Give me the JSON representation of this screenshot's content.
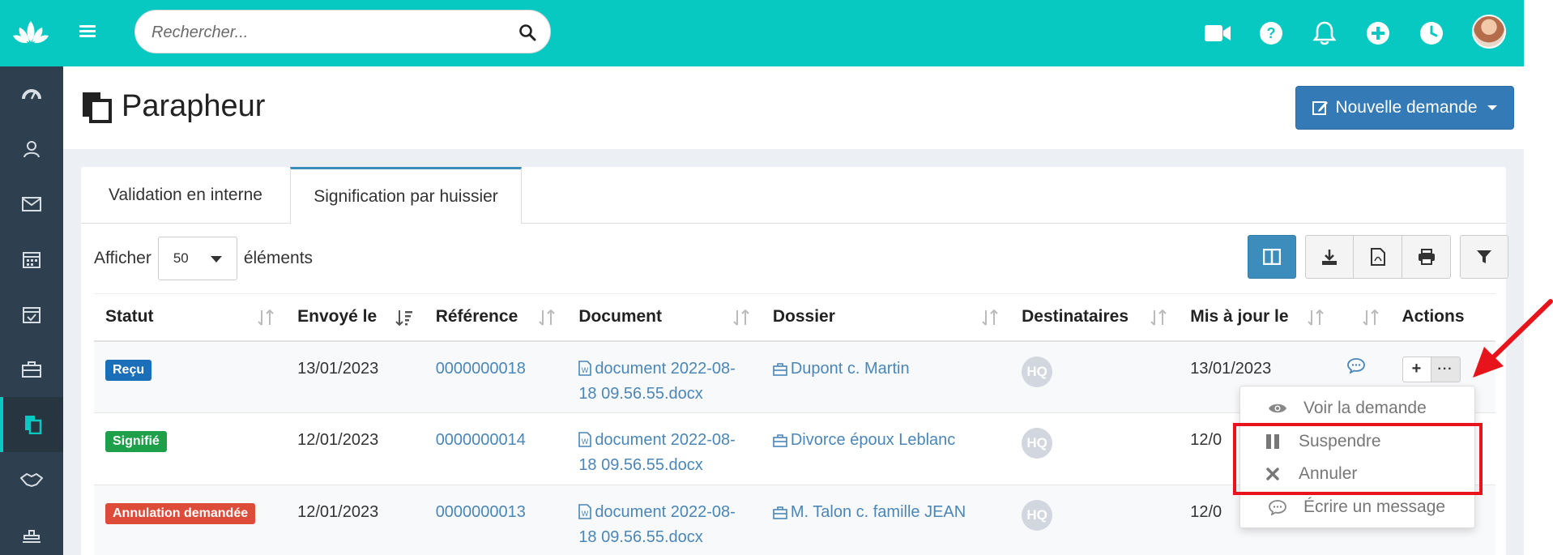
{
  "search": {
    "placeholder": "Rechercher..."
  },
  "topbar_icons": [
    "video-camera-icon",
    "question-circle-icon",
    "bell-icon",
    "plus-circle-icon",
    "clock-icon"
  ],
  "sidebar_icons": [
    "dashboard-icon",
    "contacts-icon",
    "mail-icon",
    "calendar-icon",
    "calendar-check-icon",
    "briefcase-icon",
    "parapheur-icon",
    "handshake-icon",
    "stamp-icon"
  ],
  "page": {
    "title": "Parapheur",
    "new_button": "Nouvelle demande"
  },
  "tabs": [
    {
      "label": "Validation en interne"
    },
    {
      "label": "Signification par huissier"
    }
  ],
  "length": {
    "prefix": "Afficher",
    "value": "50",
    "suffix": "éléments"
  },
  "table": {
    "headers": [
      "Statut",
      "Envoyé le",
      "Référence",
      "Document",
      "Dossier",
      "Destinataires",
      "Mis à jour le",
      "",
      "Actions"
    ],
    "rows": [
      {
        "status": "Reçu",
        "status_color": "#1a6fb8",
        "sent": "13/01/2023",
        "ref": "0000000018",
        "doc1": "document 2022-08-",
        "doc2": "18 09.56.55.docx",
        "folder": "Dupont c. Martin",
        "recipient": "HQ",
        "updated": "13/01/2023"
      },
      {
        "status": "Signifié",
        "status_color": "#1ea04a",
        "sent": "12/01/2023",
        "ref": "0000000014",
        "doc1": "document 2022-08-",
        "doc2": "18 09.56.55.docx",
        "folder": "Divorce époux Leblanc",
        "recipient": "HQ",
        "updated": "12/0"
      },
      {
        "status": "Annulation demandée",
        "status_color": "#dd4b39",
        "sent": "12/01/2023",
        "ref": "0000000013",
        "doc1": "document 2022-08-",
        "doc2": "18 09.56.55.docx",
        "folder": "M. Talon c. famille JEAN",
        "recipient": "HQ",
        "updated": "12/0"
      }
    ]
  },
  "actions": {
    "plus": "+",
    "more": "···"
  },
  "menu": {
    "items": [
      {
        "label": "Voir la demande",
        "icon": "eye-icon"
      },
      {
        "label": "Suspendre",
        "icon": "pause-icon"
      },
      {
        "label": "Annuler",
        "icon": "times-icon"
      },
      {
        "label": "Écrire un message",
        "icon": "comment-icon"
      }
    ]
  },
  "colors": {
    "topbar": "#08c9c2",
    "sidebar": "#2e3f4f",
    "primary": "#337ab7",
    "link": "#4a86b8",
    "annotation": "#e8141b"
  }
}
